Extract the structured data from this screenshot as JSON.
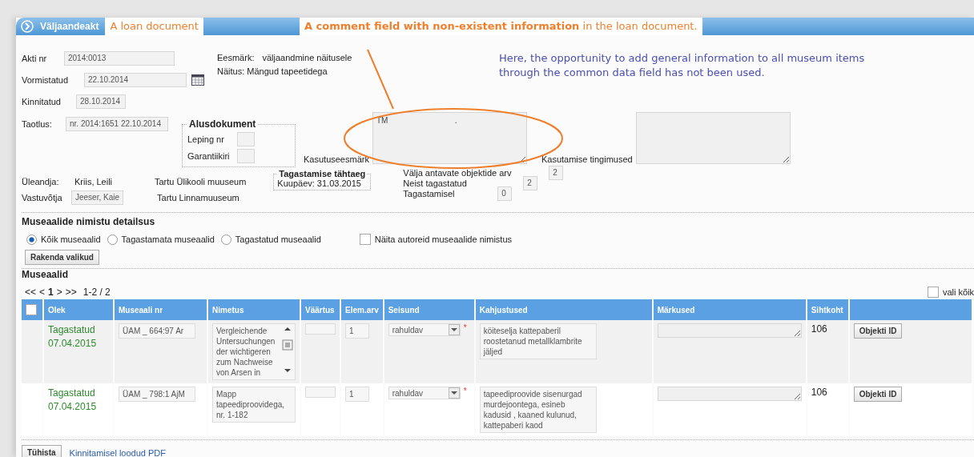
{
  "header": {
    "title": "Väljaandeakt"
  },
  "annotations": {
    "header_label": "A loan document",
    "callout": "**A comment field with non-existent information** in the loan document.",
    "note": "Here, the opportunity to add general information to all museum items through the common data field has not been used."
  },
  "document": {
    "fields": [
      {
        "label": "Akti nr",
        "value": "2014:0013",
        "calendar": false
      },
      {
        "label": "Vormistatud",
        "value": "22.10.2014",
        "calendar": true
      },
      {
        "label": "Kinnitatud",
        "value": "28.10.2014",
        "calendar": false
      }
    ],
    "purpose": {
      "label": "Eesmärk:",
      "value": "väljaandmine näitusele"
    },
    "exhibition": "Näitus: Mängud tapeetidega",
    "request": {
      "label": "Taotlus:",
      "value": "nr. 2014:1651 22.10.2014"
    },
    "base_document": {
      "legend": "Alusdokument",
      "fields": [
        {
          "label": "Leping nr"
        },
        {
          "label": "Garantiikiri"
        }
      ]
    },
    "usage_purpose": {
      "label": "Kasutuseesmärk",
      "value": "TM                              ."
    },
    "usage_terms": {
      "label": "Kasutamise tingimused"
    }
  },
  "parties": [
    {
      "label": "Üleandja:",
      "person": "Kriis, Leili",
      "kind": "text",
      "institution": "Tartu Ülikooli muuseum"
    },
    {
      "label": "Vastuvõtja",
      "person": "Jeeser, Kaie",
      "kind": "field",
      "institution": "Tartu Linnamuuseum"
    }
  ],
  "return_deadline": {
    "legend": "Tagastamise tähtaeg",
    "text": "Kuupäev: 31.03.2015"
  },
  "counts": [
    {
      "label": "Välja antavate objektide arv",
      "value": "2"
    },
    {
      "label": "Neist tagastatud",
      "value": "2"
    },
    {
      "label": "Tagastamisel",
      "value": "0"
    }
  ],
  "detail": {
    "legend": "Museaalide nimistu detailsus",
    "options": [
      {
        "label": "Kõik museaalid",
        "selected": true
      },
      {
        "label": "Tagastamata museaalid",
        "selected": false
      },
      {
        "label": "Tagastatud museaalid",
        "selected": false
      }
    ],
    "authors": {
      "label": "Näita autoreid museaalide nimistus",
      "checked": false
    },
    "apply": "Rakenda valikud"
  },
  "items": {
    "legend": "Museaalid",
    "pager": [
      {
        "text": "<<",
        "current": false
      },
      {
        "text": "<",
        "current": false
      },
      {
        "text": "1",
        "current": true
      },
      {
        "text": ">",
        "current": false
      },
      {
        "text": ">>",
        "current": false
      }
    ],
    "range": "1-2 / 2",
    "select_all": {
      "label": "vali kõik",
      "checked": false
    },
    "header_checked": false,
    "columns": [
      "Olek",
      "Museaali nr",
      "Nimetus",
      "Väärtus",
      "Elem.arv",
      "Seisund",
      "Kahjustused",
      "Märkused",
      "Sihtkoht"
    ],
    "rows": [
      {
        "status": "Tagastatud",
        "date": "07.04.2015",
        "number": "ÜAM _ 664:97 Ar",
        "name": "Vergleichende Untersuchungen der wichtigeren zum Nachweise von Arsen in",
        "scrollable": true,
        "count": "1",
        "condition": "rahuldav",
        "required": "*",
        "damages": "köiteselja kattepaberil roostetanud metallklambrite jäljed",
        "destination": "106",
        "action": "Objekti ID"
      },
      {
        "status": "Tagastatud",
        "date": "07.04.2015",
        "number": "ÜAM _ 798:1 AjM",
        "name": "Mapp tapeediproovidega, nr. 1-182",
        "scrollable": false,
        "count": "1",
        "condition": "rahuldav",
        "required": "*",
        "damages": "tapeediproovide sisenurgad murdejoontega, esineb kadusid , kaaned kulunud, kattepaberi kaod",
        "destination": "106",
        "action": "Objekti ID"
      }
    ]
  },
  "footer": {
    "cancel": "Tühista",
    "link": "Kinnitamisel loodud PDF"
  }
}
